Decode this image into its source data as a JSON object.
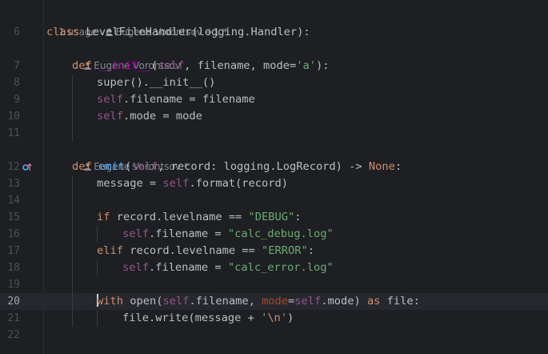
{
  "hints": {
    "usages": "1 usage",
    "class_author": "Eugene Vorontsov +1 *",
    "init_author": "Eugene Vorontsov",
    "emit_author": "Eugene Vorontsov *"
  },
  "line_numbers": [
    "6",
    "7",
    "8",
    "9",
    "10",
    "11",
    "12",
    "13",
    "14",
    "15",
    "16",
    "17",
    "18",
    "19",
    "20",
    "21",
    "22"
  ],
  "code": {
    "l6": {
      "kw": "class",
      "name": "LevelFileHandler",
      "rest": "(logging.Handler):"
    },
    "l7": {
      "kw": "def",
      "name": "__init__",
      "open": "(",
      "self": "self",
      "rest": ", filename, mode=",
      "str": "'a'",
      "close": "):"
    },
    "l8": {
      "text": "super().__init__()"
    },
    "l9": {
      "self": "self",
      "rest": ".filename = filename"
    },
    "l10": {
      "self": "self",
      "rest": ".mode = mode"
    },
    "l12": {
      "kw": "def",
      "name": "emit",
      "open": "(",
      "self": "self",
      "rest": ", record: logging.LogRecord) -> ",
      "none": "None",
      ":": ":"
    },
    "l13": {
      "pre": "message = ",
      "self": "self",
      "rest": ".format(record)"
    },
    "l15": {
      "kw": "if",
      "rest": " record.levelname == ",
      "str": "\"DEBUG\"",
      "end": ":"
    },
    "l16": {
      "self": "self",
      "rest": ".filename = ",
      "str": "\"calc_debug.log\""
    },
    "l17": {
      "kw": "elif",
      "rest": " record.levelname == ",
      "str": "\"ERROR\"",
      "end": ":"
    },
    "l18": {
      "self": "self",
      "rest": ".filename = ",
      "str": "\"calc_error.log\""
    },
    "l20": {
      "kw": "with",
      "fn": "open",
      "p1": "(",
      "self1": "self",
      "p2": ".filename, ",
      "param": "mode",
      "eq": "=",
      "self2": "self",
      "p3": ".mode) ",
      "as": "as",
      "p4": " file:"
    },
    "l21": {
      "pre": "file.write(message + ",
      "q1": "'",
      "esc": "\\n",
      "q2": "'",
      ")": ")"
    }
  },
  "colors": {
    "background": "#1e1f22",
    "keyword": "#cf8e6d",
    "function": "#56a8f5",
    "dunder": "#b200b2",
    "self": "#94558d",
    "string": "#6aab73",
    "parameter": "#aa4926",
    "text": "#bcbec4"
  },
  "icons": {
    "author": "person-icon",
    "override": "override-icon"
  }
}
